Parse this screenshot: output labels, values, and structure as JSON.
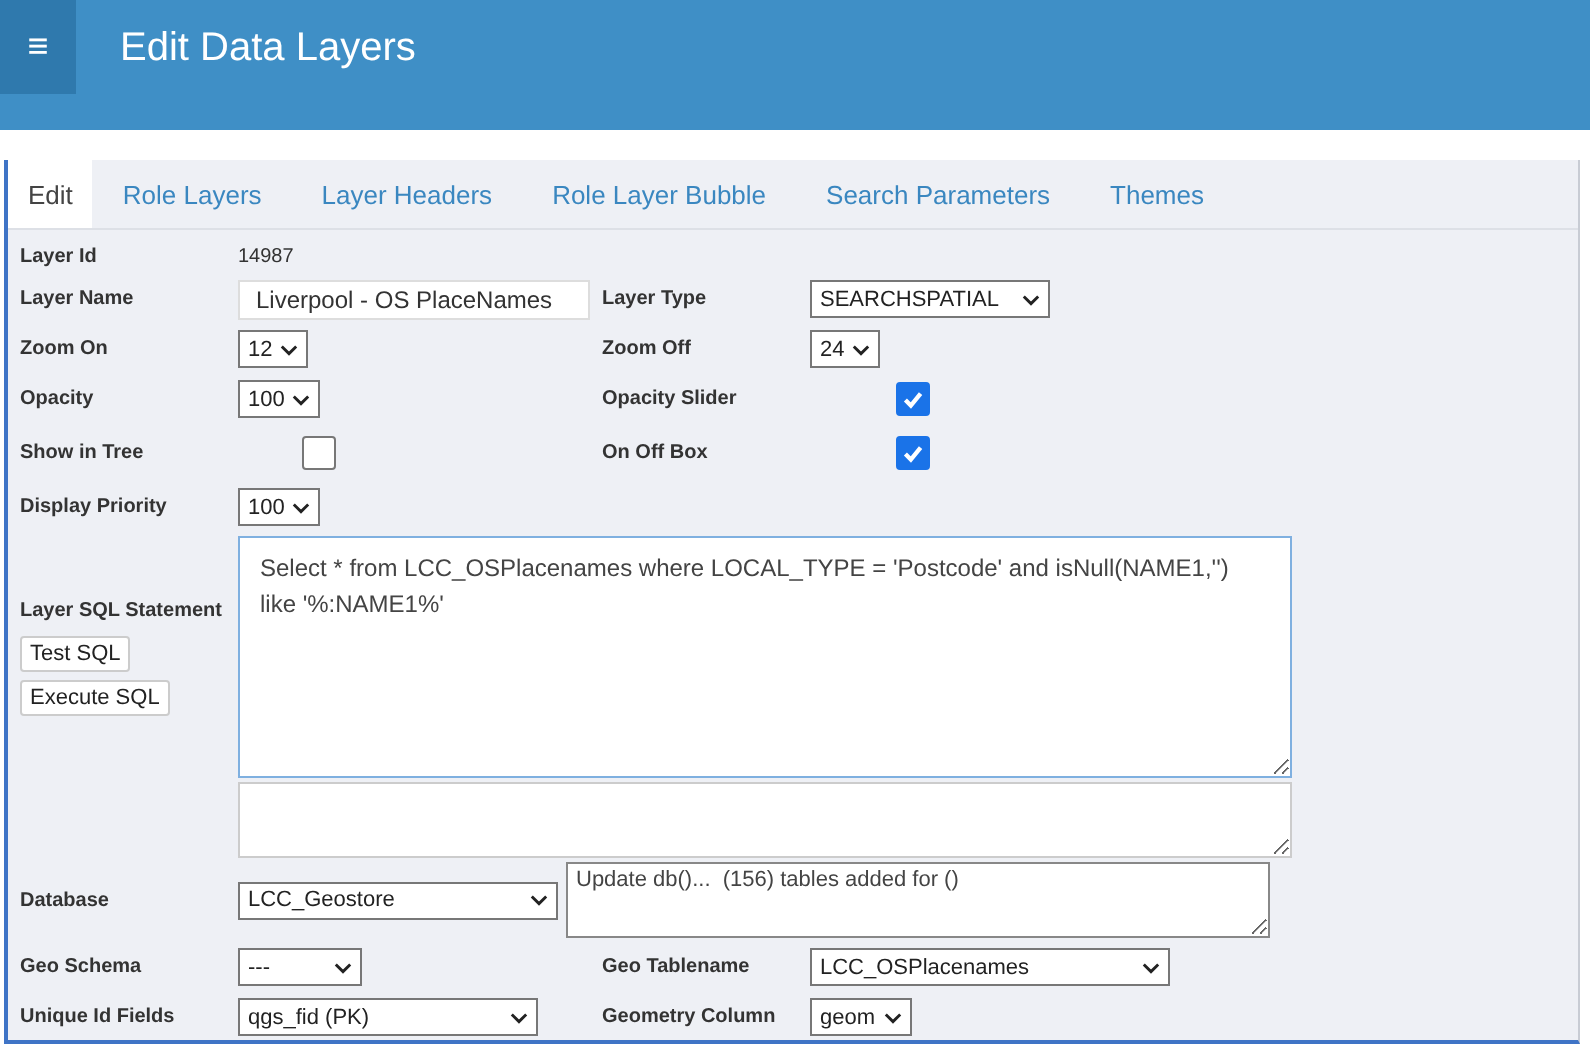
{
  "header": {
    "menu_icon": "≡",
    "title": "Edit Data Layers"
  },
  "tabs": [
    {
      "label": "Edit",
      "selected": true
    },
    {
      "label": "Role Layers",
      "selected": false
    },
    {
      "label": "Layer Headers",
      "selected": false
    },
    {
      "label": "Role Layer Bubble",
      "selected": false
    },
    {
      "label": "Search Parameters",
      "selected": false
    },
    {
      "label": "Themes",
      "selected": false
    }
  ],
  "form": {
    "layer_id": {
      "label": "Layer Id",
      "value": "14987"
    },
    "layer_name": {
      "label": "Layer Name",
      "value": "Liverpool - OS PlaceNames"
    },
    "layer_type": {
      "label": "Layer Type",
      "value": "SEARCHSPATIAL"
    },
    "zoom_on": {
      "label": "Zoom On",
      "value": "12"
    },
    "zoom_off": {
      "label": "Zoom Off",
      "value": "24"
    },
    "opacity": {
      "label": "Opacity",
      "value": "100"
    },
    "opacity_slider": {
      "label": "Opacity Slider",
      "checked": true
    },
    "show_in_tree": {
      "label": "Show in Tree",
      "checked": false
    },
    "on_off_box": {
      "label": "On Off Box",
      "checked": true
    },
    "display_priority": {
      "label": "Display Priority",
      "value": "100"
    },
    "sql": {
      "label": "Layer SQL Statement",
      "value": "Select * from LCC_OSPlacenames where LOCAL_TYPE = 'Postcode' and isNull(NAME1,'') like '%:NAME1%'",
      "buttons": [
        "Test SQL",
        "Execute SQL"
      ]
    },
    "database": {
      "label": "Database",
      "value": "LCC_Geostore",
      "log": "Update db()...  (156) tables added for ()"
    },
    "geo_schema": {
      "label": "Geo Schema",
      "value": "---"
    },
    "geo_tablename": {
      "label": "Geo Tablename",
      "value": "LCC_OSPlacenames"
    },
    "unique_id_fields": {
      "label": "Unique Id Fields",
      "value": "qgs_fid (PK)"
    },
    "geometry_column": {
      "label": "Geometry Column",
      "value": "geom"
    }
  }
}
